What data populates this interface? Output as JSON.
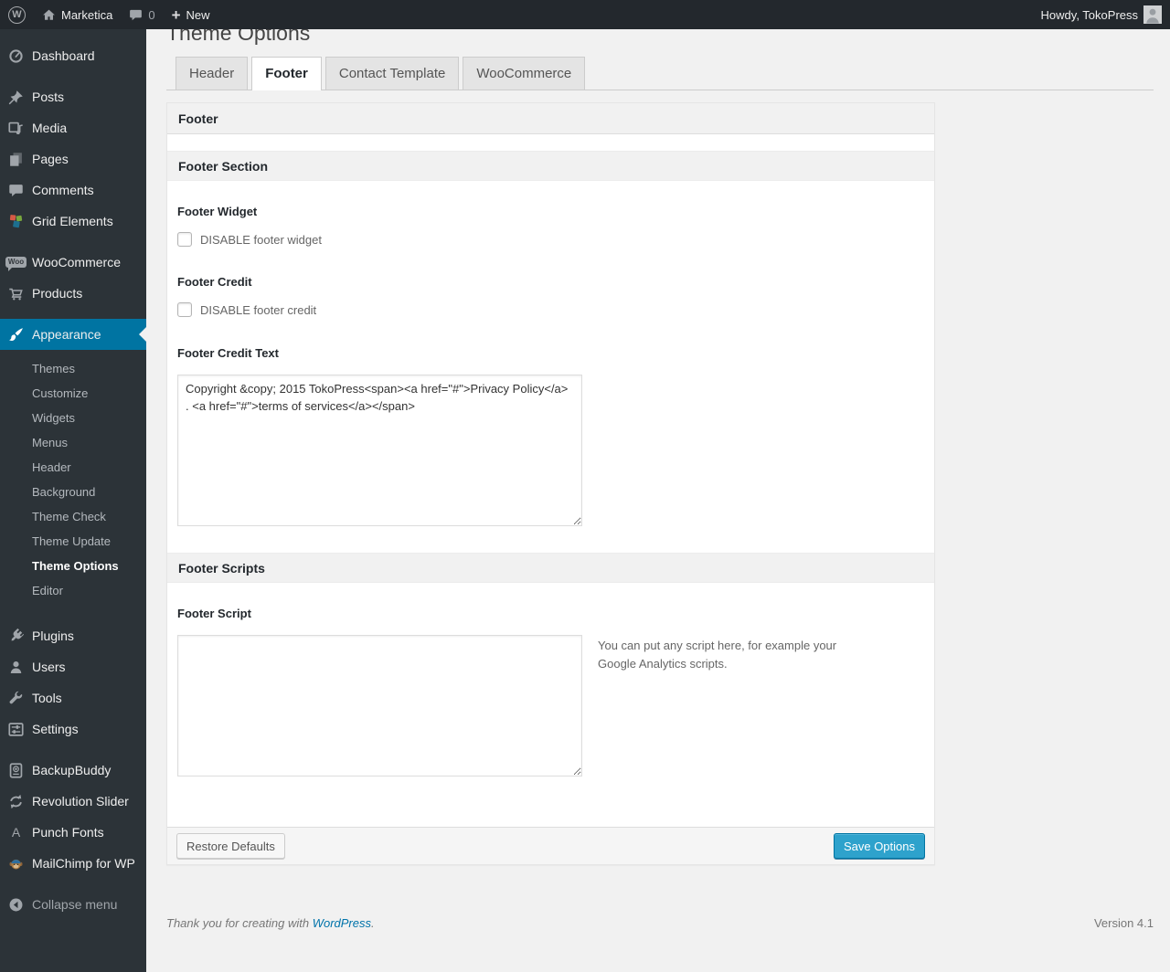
{
  "colors": {
    "accent": "#0074a2",
    "primary_button": "#2ea2cc",
    "link": "#0073aa",
    "admin_bar_bg": "#23282d",
    "sidebar_bg": "#2c3338"
  },
  "admin_bar": {
    "wp_logo_icon": "wordpress-logo-icon",
    "home_icon": "home-icon",
    "site_name": "Marketica",
    "comment_icon": "comment-bubble-icon",
    "comment_count": "0",
    "plus_icon": "plus-icon",
    "new_label": "New",
    "howdy": "Howdy, TokoPress",
    "avatar_icon": "avatar"
  },
  "sidebar": {
    "groups": [
      {
        "items": [
          {
            "label": "Dashboard",
            "icon": "dashboard-icon"
          }
        ]
      },
      {
        "items": [
          {
            "label": "Posts",
            "icon": "pin-icon"
          },
          {
            "label": "Media",
            "icon": "media-icon"
          },
          {
            "label": "Pages",
            "icon": "pages-icon"
          },
          {
            "label": "Comments",
            "icon": "comments-icon"
          },
          {
            "label": "Grid Elements",
            "icon": "grid-elements-icon"
          }
        ]
      },
      {
        "items": [
          {
            "label": "WooCommerce",
            "icon": "woocommerce-icon"
          },
          {
            "label": "Products",
            "icon": "cart-icon"
          }
        ]
      },
      {
        "items": [
          {
            "label": "Appearance",
            "icon": "brush-icon",
            "active": true,
            "submenu": [
              "Themes",
              "Customize",
              "Widgets",
              "Menus",
              "Header",
              "Background",
              "Theme Check",
              "Theme Update",
              "Theme Options",
              "Editor"
            ],
            "current_submenu": "Theme Options"
          }
        ]
      },
      {
        "items": [
          {
            "label": "Plugins",
            "icon": "plugin-icon"
          },
          {
            "label": "Users",
            "icon": "users-icon"
          },
          {
            "label": "Tools",
            "icon": "wrench-icon"
          },
          {
            "label": "Settings",
            "icon": "settings-icon"
          }
        ]
      },
      {
        "items": [
          {
            "label": "BackupBuddy",
            "icon": "backup-drive-icon"
          },
          {
            "label": "Revolution Slider",
            "icon": "refresh-arrows-icon"
          },
          {
            "label": "Punch Fonts",
            "icon": "letter-a-icon"
          },
          {
            "label": "MailChimp for WP",
            "icon": "mailchimp-monkey-icon"
          }
        ]
      },
      {
        "items": [
          {
            "label": "Collapse menu",
            "icon": "collapse-arrow-icon",
            "muted": true
          }
        ]
      }
    ]
  },
  "main": {
    "title": "Theme Options",
    "tabs": [
      {
        "label": "Header"
      },
      {
        "label": "Footer",
        "active": true
      },
      {
        "label": "Contact Template"
      },
      {
        "label": "WooCommerce"
      }
    ],
    "panel": {
      "box_title": "Footer",
      "section1_title": "Footer Section",
      "footer_widget_label": "Footer Widget",
      "footer_widget_checkbox": "DISABLE footer widget",
      "footer_widget_checked": false,
      "footer_credit_label": "Footer Credit",
      "footer_credit_checkbox": "DISABLE footer credit",
      "footer_credit_checked": false,
      "footer_credit_text_label": "Footer Credit Text",
      "footer_credit_text_value": "Copyright &copy; 2015 TokoPress<span><a href=\"#\">Privacy Policy</a> . <a href=\"#\">terms of services</a></span>",
      "section2_title": "Footer Scripts",
      "footer_script_label": "Footer Script",
      "footer_script_value": "",
      "footer_script_help": "You can put any script here, for example your Google Analytics scripts.",
      "restore_button": "Restore Defaults",
      "save_button": "Save Options"
    }
  },
  "page_footer": {
    "thanks_prefix": "Thank you for creating with ",
    "wordpress_link": "WordPress",
    "thanks_suffix": ".",
    "version": "Version 4.1"
  }
}
